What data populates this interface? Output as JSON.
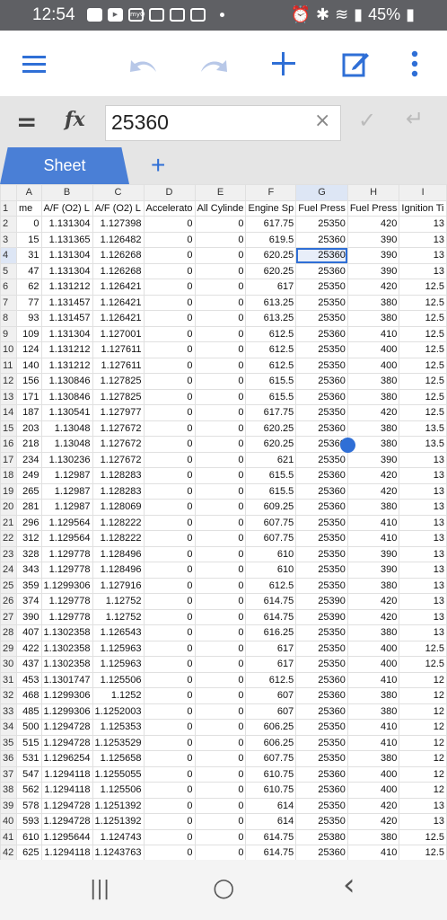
{
  "status_bar": {
    "time": "12:54",
    "battery": "45%",
    "icons": [
      "snapchat-icon",
      "youtube-icon",
      "myq-icon",
      "news-icon",
      "news2-icon",
      "news3-icon",
      "dot-icon",
      "alarm-icon",
      "bluetooth-icon",
      "wifi-icon",
      "signal-icon",
      "battery-icon"
    ]
  },
  "toolbar": {
    "icons": [
      "menu-icon",
      "undo-icon",
      "redo-icon",
      "add-icon",
      "edit-icon",
      "more-icon"
    ],
    "accent": "#4a7fd6"
  },
  "formula_bar": {
    "equals": "=",
    "fx": "fx",
    "value": "25360",
    "clear_icon": "×",
    "confirm_icon": "✓",
    "enter_icon": "↵"
  },
  "tabs": {
    "sheet_label": "Sheet",
    "add_label": "+"
  },
  "grid": {
    "columns": [
      "A",
      "B",
      "C",
      "D",
      "E",
      "F",
      "G",
      "H",
      "I"
    ],
    "selected_col": "G",
    "selected_row": 4,
    "headers": [
      "me",
      "A/F (O2) L",
      "A/F (O2) L",
      "Accelerato",
      "All Cylinde",
      "Engine Sp",
      "Fuel Press",
      "Fuel Press",
      "Ignition Ti"
    ],
    "rows": [
      [
        "0",
        "1.131304",
        "1.127398",
        "0",
        "0",
        "617.75",
        "25350",
        "420",
        "13"
      ],
      [
        "15",
        "1.131365",
        "1.126482",
        "0",
        "0",
        "619.5",
        "25360",
        "390",
        "13"
      ],
      [
        "31",
        "1.131304",
        "1.126268",
        "0",
        "0",
        "620.25",
        "25360",
        "390",
        "13"
      ],
      [
        "47",
        "1.131304",
        "1.126268",
        "0",
        "0",
        "620.25",
        "25360",
        "390",
        "13"
      ],
      [
        "62",
        "1.131212",
        "1.126421",
        "0",
        "0",
        "617",
        "25350",
        "420",
        "12.5"
      ],
      [
        "77",
        "1.131457",
        "1.126421",
        "0",
        "0",
        "613.25",
        "25350",
        "380",
        "12.5"
      ],
      [
        "93",
        "1.131457",
        "1.126421",
        "0",
        "0",
        "613.25",
        "25350",
        "380",
        "12.5"
      ],
      [
        "109",
        "1.131304",
        "1.127001",
        "0",
        "0",
        "612.5",
        "25360",
        "410",
        "12.5"
      ],
      [
        "124",
        "1.131212",
        "1.127611",
        "0",
        "0",
        "612.5",
        "25350",
        "400",
        "12.5"
      ],
      [
        "140",
        "1.131212",
        "1.127611",
        "0",
        "0",
        "612.5",
        "25350",
        "400",
        "12.5"
      ],
      [
        "156",
        "1.130846",
        "1.127825",
        "0",
        "0",
        "615.5",
        "25360",
        "380",
        "12.5"
      ],
      [
        "171",
        "1.130846",
        "1.127825",
        "0",
        "0",
        "615.5",
        "25360",
        "380",
        "12.5"
      ],
      [
        "187",
        "1.130541",
        "1.127977",
        "0",
        "0",
        "617.75",
        "25350",
        "420",
        "12.5"
      ],
      [
        "203",
        "1.13048",
        "1.127672",
        "0",
        "0",
        "620.25",
        "25360",
        "380",
        "13.5"
      ],
      [
        "218",
        "1.13048",
        "1.127672",
        "0",
        "0",
        "620.25",
        "25360",
        "380",
        "13.5"
      ],
      [
        "234",
        "1.130236",
        "1.127672",
        "0",
        "0",
        "621",
        "25350",
        "390",
        "13"
      ],
      [
        "249",
        "1.12987",
        "1.128283",
        "0",
        "0",
        "615.5",
        "25360",
        "420",
        "13"
      ],
      [
        "265",
        "1.12987",
        "1.128283",
        "0",
        "0",
        "615.5",
        "25360",
        "420",
        "13"
      ],
      [
        "281",
        "1.12987",
        "1.128069",
        "0",
        "0",
        "609.25",
        "25360",
        "380",
        "13"
      ],
      [
        "296",
        "1.129564",
        "1.128222",
        "0",
        "0",
        "607.75",
        "25350",
        "410",
        "13"
      ],
      [
        "312",
        "1.129564",
        "1.128222",
        "0",
        "0",
        "607.75",
        "25350",
        "410",
        "13"
      ],
      [
        "328",
        "1.129778",
        "1.128496",
        "0",
        "0",
        "610",
        "25350",
        "390",
        "13"
      ],
      [
        "343",
        "1.129778",
        "1.128496",
        "0",
        "0",
        "610",
        "25350",
        "390",
        "13"
      ],
      [
        "359",
        "1.1299306",
        "1.127916",
        "0",
        "0",
        "612.5",
        "25350",
        "380",
        "13"
      ],
      [
        "374",
        "1.129778",
        "1.12752",
        "0",
        "0",
        "614.75",
        "25390",
        "420",
        "13"
      ],
      [
        "390",
        "1.129778",
        "1.12752",
        "0",
        "0",
        "614.75",
        "25390",
        "420",
        "13"
      ],
      [
        "407",
        "1.1302358",
        "1.126543",
        "0",
        "0",
        "616.25",
        "25350",
        "380",
        "13"
      ],
      [
        "422",
        "1.1302358",
        "1.125963",
        "0",
        "0",
        "617",
        "25350",
        "400",
        "12.5"
      ],
      [
        "437",
        "1.1302358",
        "1.125963",
        "0",
        "0",
        "617",
        "25350",
        "400",
        "12.5"
      ],
      [
        "453",
        "1.1301747",
        "1.125506",
        "0",
        "0",
        "612.5",
        "25360",
        "410",
        "12"
      ],
      [
        "468",
        "1.1299306",
        "1.1252",
        "0",
        "0",
        "607",
        "25360",
        "380",
        "12"
      ],
      [
        "485",
        "1.1299306",
        "1.1252003",
        "0",
        "0",
        "607",
        "25360",
        "380",
        "12"
      ],
      [
        "500",
        "1.1294728",
        "1.125353",
        "0",
        "0",
        "606.25",
        "25350",
        "410",
        "12"
      ],
      [
        "515",
        "1.1294728",
        "1.1253529",
        "0",
        "0",
        "606.25",
        "25350",
        "410",
        "12"
      ],
      [
        "531",
        "1.1296254",
        "1.125658",
        "0",
        "0",
        "607.75",
        "25350",
        "380",
        "12"
      ],
      [
        "547",
        "1.1294118",
        "1.1255055",
        "0",
        "0",
        "610.75",
        "25360",
        "400",
        "12"
      ],
      [
        "562",
        "1.1294118",
        "1.125506",
        "0",
        "0",
        "610.75",
        "25360",
        "400",
        "12"
      ],
      [
        "578",
        "1.1294728",
        "1.1251392",
        "0",
        "0",
        "614",
        "25350",
        "420",
        "13"
      ],
      [
        "593",
        "1.1294728",
        "1.1251392",
        "0",
        "0",
        "614",
        "25350",
        "420",
        "13"
      ],
      [
        "610",
        "1.1295644",
        "1.124743",
        "0",
        "0",
        "614.75",
        "25380",
        "380",
        "12.5"
      ],
      [
        "625",
        "1.1294118",
        "1.1243763",
        "0",
        "0",
        "614.75",
        "25360",
        "410",
        "12.5"
      ]
    ]
  },
  "nav_bar": {
    "recents": "|||",
    "home": "○",
    "back": "‹"
  }
}
